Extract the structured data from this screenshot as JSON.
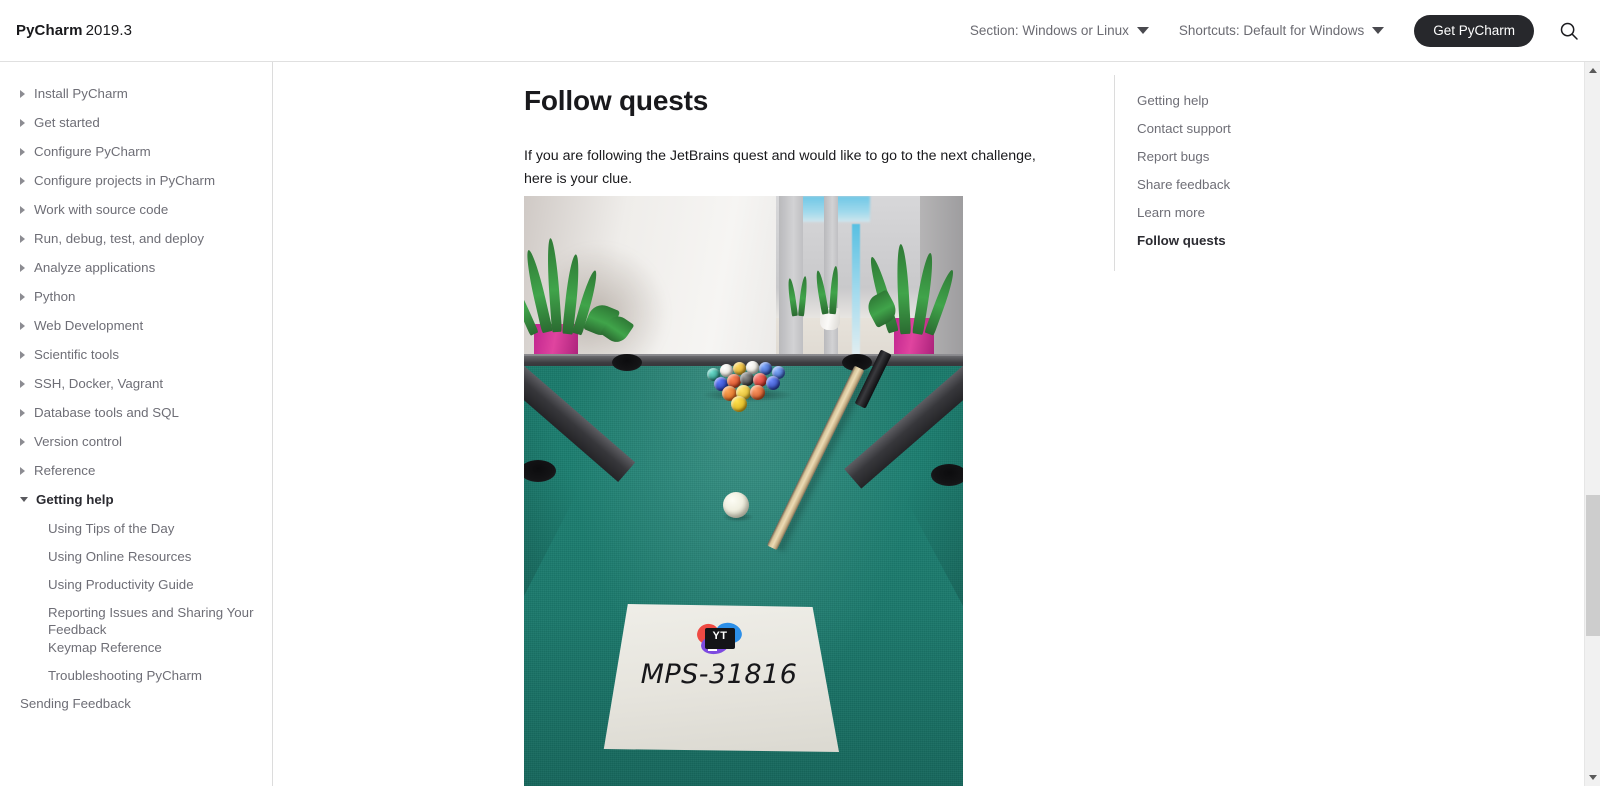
{
  "header": {
    "brand_product": "PyCharm",
    "brand_version": "2019.3",
    "section_select": "Section: Windows or Linux",
    "shortcuts_select": "Shortcuts: Default for Windows",
    "cta_label": "Get PyCharm",
    "search_icon": "search-icon",
    "cta_bg_color": "#27282c"
  },
  "sidebar": {
    "items": [
      {
        "label": "Install PyCharm",
        "level": 0,
        "expanded": false,
        "active": false,
        "has_toggle": true
      },
      {
        "label": "Get started",
        "level": 0,
        "expanded": false,
        "active": false,
        "has_toggle": true
      },
      {
        "label": "Configure PyCharm",
        "level": 0,
        "expanded": false,
        "active": false,
        "has_toggle": true
      },
      {
        "label": "Configure projects in PyCharm",
        "level": 0,
        "expanded": false,
        "active": false,
        "has_toggle": true
      },
      {
        "label": "Work with source code",
        "level": 0,
        "expanded": false,
        "active": false,
        "has_toggle": true
      },
      {
        "label": "Run, debug, test, and deploy",
        "level": 0,
        "expanded": false,
        "active": false,
        "has_toggle": true
      },
      {
        "label": "Analyze applications",
        "level": 0,
        "expanded": false,
        "active": false,
        "has_toggle": true
      },
      {
        "label": "Python",
        "level": 0,
        "expanded": false,
        "active": false,
        "has_toggle": true
      },
      {
        "label": "Web Development",
        "level": 0,
        "expanded": false,
        "active": false,
        "has_toggle": true
      },
      {
        "label": "Scientific tools",
        "level": 0,
        "expanded": false,
        "active": false,
        "has_toggle": true
      },
      {
        "label": "SSH, Docker, Vagrant",
        "level": 0,
        "expanded": false,
        "active": false,
        "has_toggle": true
      },
      {
        "label": "Database tools and SQL",
        "level": 0,
        "expanded": false,
        "active": false,
        "has_toggle": true
      },
      {
        "label": "Version control",
        "level": 0,
        "expanded": false,
        "active": false,
        "has_toggle": true
      },
      {
        "label": "Reference",
        "level": 0,
        "expanded": false,
        "active": false,
        "has_toggle": true
      },
      {
        "label": "Getting help",
        "level": 0,
        "expanded": true,
        "active": true,
        "has_toggle": true
      },
      {
        "label": "Using Tips of the Day",
        "level": 1,
        "expanded": false,
        "active": false,
        "has_toggle": false
      },
      {
        "label": "Using Online Resources",
        "level": 1,
        "expanded": false,
        "active": false,
        "has_toggle": false
      },
      {
        "label": "Using Productivity Guide",
        "level": 1,
        "expanded": false,
        "active": false,
        "has_toggle": false
      },
      {
        "label": "Reporting Issues and Sharing Your Feedback",
        "level": 1,
        "expanded": false,
        "active": false,
        "has_toggle": false
      },
      {
        "label": "Keymap Reference",
        "level": 1,
        "expanded": false,
        "active": false,
        "has_toggle": false
      },
      {
        "label": "Troubleshooting PyCharm",
        "level": 1,
        "expanded": false,
        "active": false,
        "has_toggle": false
      },
      {
        "label": "Sending Feedback",
        "level": 0,
        "expanded": false,
        "active": false,
        "has_toggle": false
      }
    ]
  },
  "article": {
    "title": "Follow quests",
    "paragraph": "If you are following the JetBrains quest and would like to go to the next challenge, here is your clue."
  },
  "photo": {
    "alt": "Pool table in an office with a paper sign on it",
    "sign_text": "MPS-31816",
    "sign_logo_text": "YT",
    "felt_color": "#1d7a6b",
    "pot_color": "#c0258f"
  },
  "toc": {
    "items": [
      {
        "label": "Getting help",
        "active": false
      },
      {
        "label": "Contact support",
        "active": false
      },
      {
        "label": "Report bugs",
        "active": false
      },
      {
        "label": "Share feedback",
        "active": false
      },
      {
        "label": "Learn more",
        "active": false
      },
      {
        "label": "Follow quests",
        "active": true
      }
    ]
  },
  "scrollbar": {
    "track_color": "#f1f1f1",
    "thumb_color": "#cdcdcd"
  }
}
